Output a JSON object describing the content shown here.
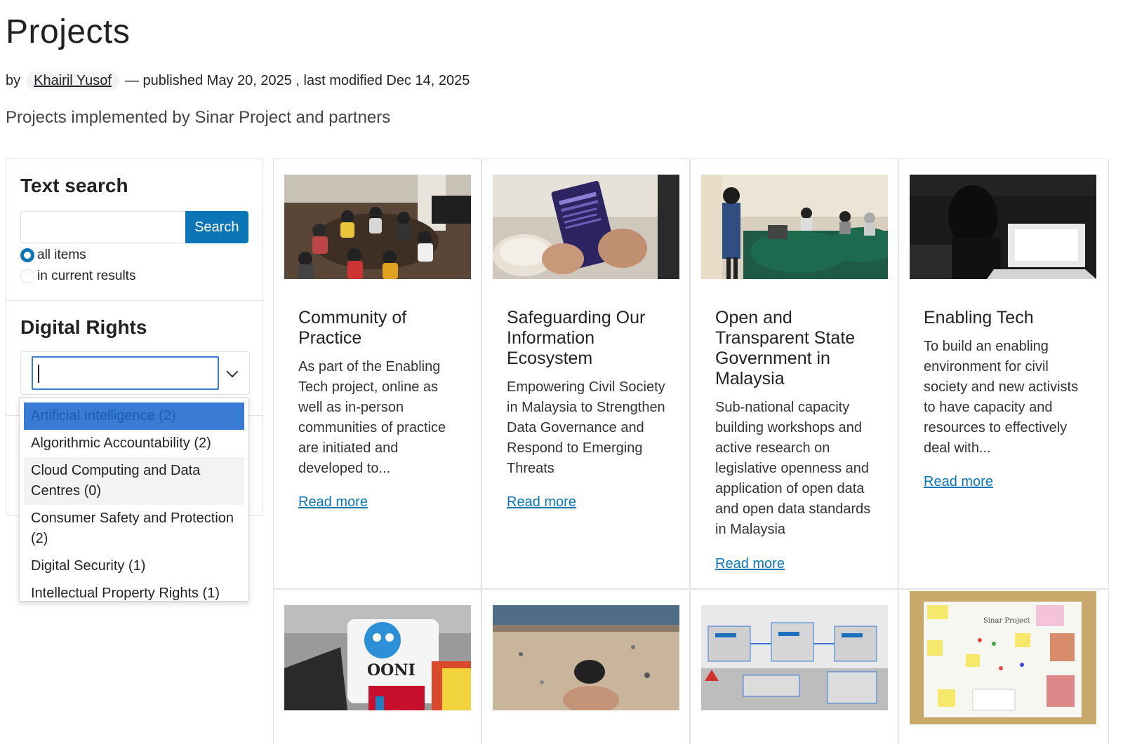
{
  "page": {
    "title": "Projects",
    "byline_prefix": "by",
    "author": "Khairil Yusof",
    "byline_suffix": "— published May 20, 2025 , last modified Dec 14, 2025",
    "description": "Projects implemented by Sinar Project and partners"
  },
  "sidebar": {
    "search_heading": "Text search",
    "search_button": "Search",
    "search_value": "",
    "radio_options": [
      {
        "label": "all items",
        "checked": true
      },
      {
        "label": "in current results",
        "checked": false
      }
    ],
    "rights_heading": "Digital Rights",
    "select_value": "",
    "options": [
      "Artificial Intelligence (2)",
      "Algorithmic Accountability (2)",
      "Cloud Computing and Data Centres (0)",
      "Consumer Safety and Protection (2)",
      "Digital Security (1)",
      "Intellectual Property Rights (1)"
    ]
  },
  "cards": [
    {
      "title": "Community of Practice",
      "excerpt": "As part of the Enabling Tech project, online as well as in-person communities of practice are initiated and developed to...",
      "readmore": "Read more",
      "image": "photo-people-circle-floor"
    },
    {
      "title": "Safeguarding Our Information Ecosystem",
      "excerpt": "Empowering Civil Society in Malaysia to Strengthen Data Governance and Respond to Emerging Threats",
      "readmore": "Read more",
      "image": "photo-hands-holding-booklet"
    },
    {
      "title": "Open and Transparent State Government in Malaysia",
      "excerpt": "Sub-national capacity building workshops and active research on legislative openness and application of open data and open data standards in Malaysia",
      "readmore": "Read more",
      "image": "photo-workshop-presentation"
    },
    {
      "title": "Enabling Tech",
      "excerpt": "To build an enabling environment for civil society and new activists to have capacity and resources to effectively deal with...",
      "readmore": "Read more",
      "image": "photo-laptop-dark-room"
    }
  ],
  "cards_row2": [
    {
      "image": "photo-ooni-raspberry-pi",
      "logo_text": "OONI"
    },
    {
      "image": "photo-hand-stone-beach"
    },
    {
      "image": "diagram-open-data-flow"
    },
    {
      "image": "photo-sticky-notes-board",
      "board_text": "Sinar Project"
    }
  ],
  "colors": {
    "accent": "#0b75b5",
    "highlight": "#3a7bd5",
    "border": "#e3e3e3"
  }
}
